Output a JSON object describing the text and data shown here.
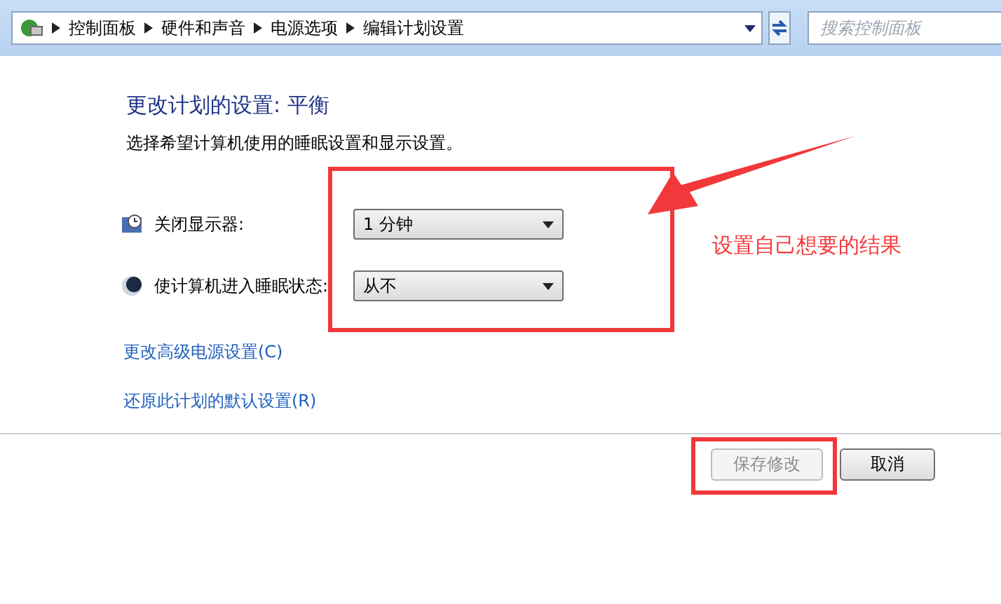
{
  "address_bar": {
    "breadcrumbs": [
      "控制面板",
      "硬件和声音",
      "电源选项",
      "编辑计划设置"
    ],
    "search": {
      "placeholder": "搜索控制面板"
    }
  },
  "heading": "更改计划的设置: 平衡",
  "description": "选择希望计算机使用的睡眠设置和显示设置。",
  "settings": [
    {
      "kind": "display",
      "label": "关闭显示器:",
      "value": "1 分钟"
    },
    {
      "kind": "sleep",
      "label": "使计算机进入睡眠状态:",
      "value": "从不"
    }
  ],
  "links": [
    "更改高级电源设置(C)",
    "还原此计划的默认设置(R)"
  ],
  "buttons": [
    {
      "label": "保存修改",
      "disabled": true
    },
    {
      "label": "取消",
      "disabled": false
    }
  ],
  "annotation": {
    "text": "设置自己想要的结果"
  }
}
